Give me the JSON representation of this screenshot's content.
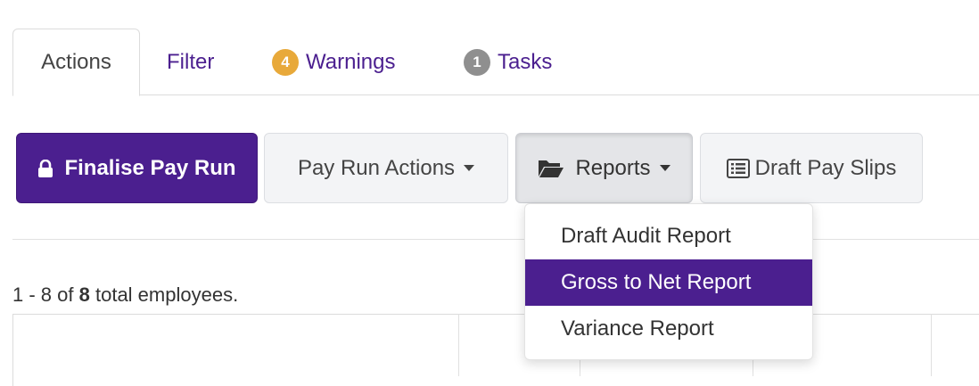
{
  "tabs": {
    "actions": "Actions",
    "filter": "Filter",
    "warnings": {
      "count": "4",
      "label": "Warnings"
    },
    "tasks": {
      "count": "1",
      "label": "Tasks"
    }
  },
  "toolbar": {
    "finalise": "Finalise Pay Run",
    "pay_run_actions": "Pay Run Actions",
    "reports": "Reports",
    "draft_pay_slips": "Draft Pay Slips"
  },
  "reports_menu": {
    "items": [
      "Draft Audit Report",
      "Gross to Net Report",
      "Variance Report"
    ],
    "highlighted": "Gross to Net Report"
  },
  "summary": {
    "range": "1 - 8 of",
    "total": "8",
    "suffix": "total employees."
  },
  "colors": {
    "brand": "#4b1f8f",
    "warning_badge": "#e8a93a",
    "task_badge": "#8f8f8f"
  }
}
